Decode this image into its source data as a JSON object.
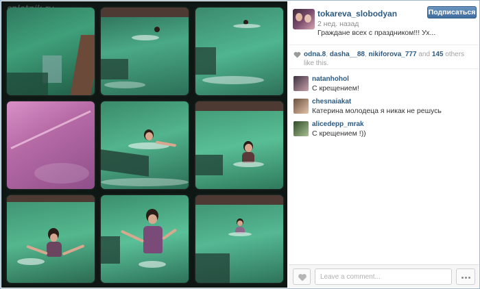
{
  "post": {
    "username": "tokareva_slobodyan",
    "time": "2 нед. назад",
    "caption": "Граждане всех с праздником!!! Ух...",
    "follow_label": "Подписаться"
  },
  "likes": {
    "users": [
      "odna.8",
      "dasha__88",
      "nikiforova_777"
    ],
    "separator_1": ", ",
    "separator_2": ", ",
    "and_text": " and ",
    "others_count": "145",
    "others_text": " others like this."
  },
  "comments": [
    {
      "user": "natanhohol",
      "text": "С крещением!"
    },
    {
      "user": "chesnaiakat",
      "text": "Катерина молодеца я никак не решусь"
    },
    {
      "user": "alicedepp_mrak",
      "text": "С крещением !))"
    }
  ],
  "footer": {
    "comment_placeholder": "Leave a comment..."
  },
  "watermark": "spletnik.ru",
  "icons": [
    "heart-icon",
    "more-dots-icon"
  ],
  "colors": {
    "link": "#2c5a82",
    "button": "#3f6d9e"
  }
}
